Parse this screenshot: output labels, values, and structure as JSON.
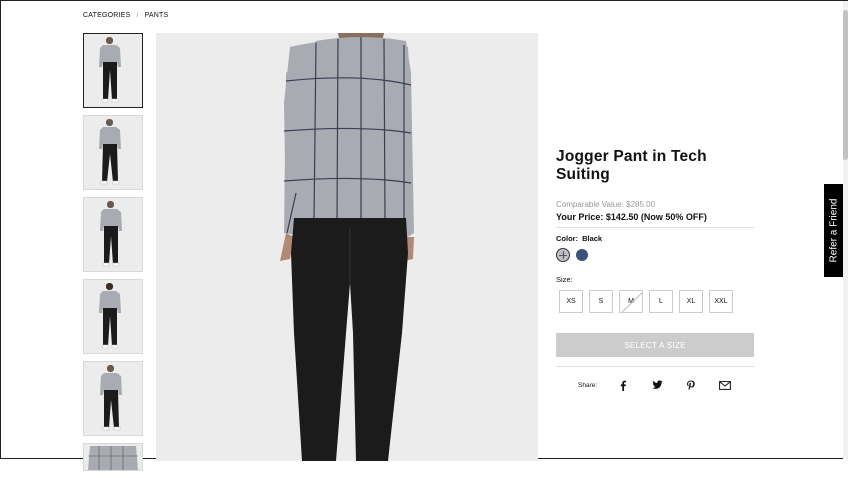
{
  "breadcrumb": {
    "items": [
      "CATEGORIES",
      "PANTS"
    ],
    "separator": "/"
  },
  "thumbnails": {
    "count": 6,
    "active_index": 0
  },
  "product": {
    "title": "Jogger Pant in Tech Suiting",
    "comparable_value": "Comparable Value: $285.00",
    "your_price": "Your Price: $142.50 (Now 50% OFF)",
    "color_label": "Color:",
    "color_value": "Black",
    "swatches": [
      {
        "name": "grey-windowpane",
        "color": "#bfc3c8"
      },
      {
        "name": "navy",
        "color": "#3d4f7a"
      }
    ],
    "size_label": "Size:",
    "sizes": [
      {
        "label": "XS",
        "available": true
      },
      {
        "label": "S",
        "available": true
      },
      {
        "label": "M",
        "available": false
      },
      {
        "label": "L",
        "available": true
      },
      {
        "label": "XL",
        "available": true
      },
      {
        "label": "XXL",
        "available": true
      }
    ],
    "select_button": "SELECT A SIZE",
    "share_label": "Share:",
    "share_icons": [
      "facebook-icon",
      "twitter-icon",
      "pinterest-icon",
      "email-icon"
    ]
  },
  "refer_tab": "Refer a Friend",
  "colors": {
    "button_disabled": "#cccccc",
    "image_bg": "#ececec",
    "sweater": "#a9abb3",
    "pants": "#1b1b1b"
  }
}
